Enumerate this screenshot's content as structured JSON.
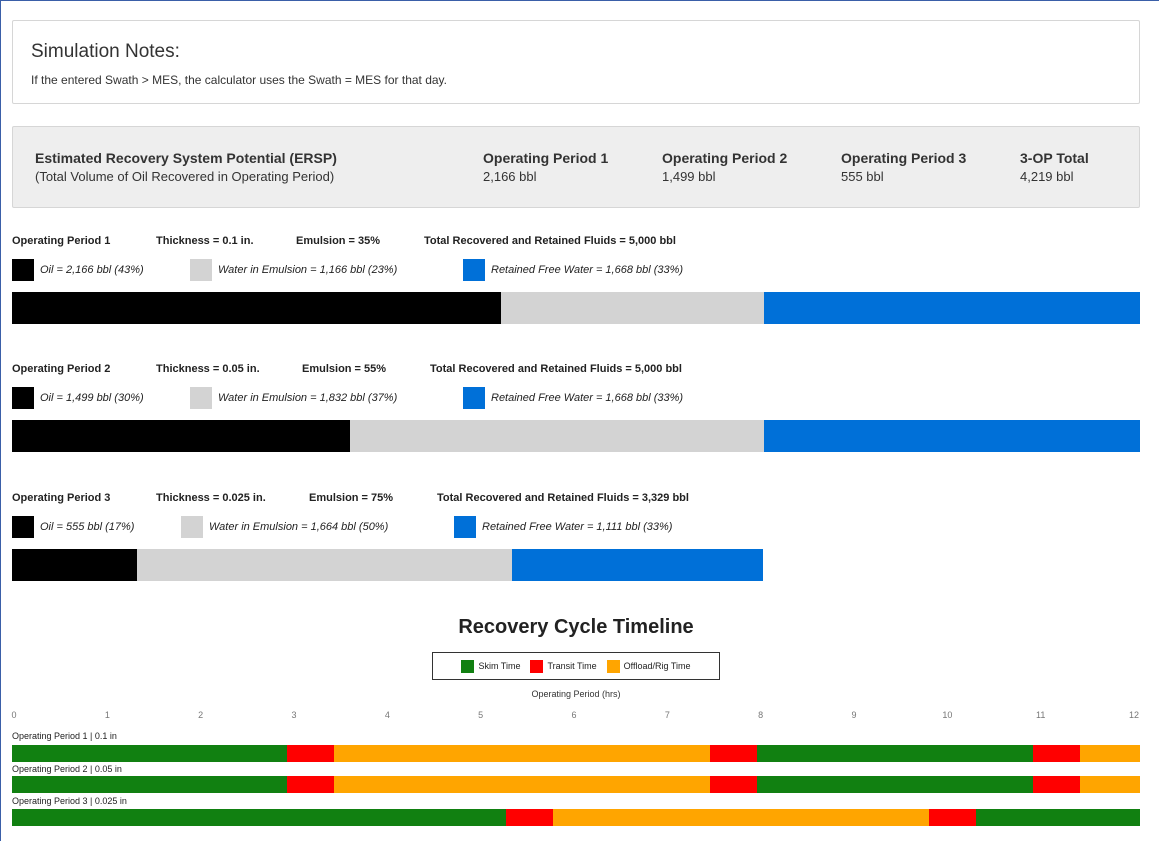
{
  "notes": {
    "title": "Simulation Notes:",
    "text": "If the entered Swath > MES, the calculator uses the Swath = MES for that day."
  },
  "ersp": {
    "label_main": "Estimated Recovery System Potential (ERSP)",
    "label_sub": "(Total Volume of Oil Recovered in Operating Period)",
    "columns": [
      {
        "header": "Operating Period 1",
        "value": "2,166 bbl"
      },
      {
        "header": "Operating Period 2",
        "value": "1,499 bbl"
      },
      {
        "header": "Operating Period 3",
        "value": "555 bbl"
      },
      {
        "header": "3-OP Total",
        "value": "4,219 bbl"
      }
    ]
  },
  "colors": {
    "oil": "#000000",
    "emulsion": "#d3d3d3",
    "free_water": "#0070d8",
    "skim": "#118011",
    "transit": "#ff0000",
    "offload": "#ffa500"
  },
  "periods": [
    {
      "name": "Operating Period 1",
      "thickness": "Thickness = 0.1 in.",
      "emulsion": "Emulsion = 35%",
      "total": "Total Recovered and Retained Fluids = 5,000 bbl",
      "legend": {
        "oil": "Oil = 2,166 bbl (43%)",
        "emulsion": "Water in Emulsion = 1,166 bbl (23%)",
        "free_water": "Retained Free Water = 1,668 bbl (33%)"
      },
      "bar": {
        "total_fraction": 1.0,
        "oil": 2166,
        "emulsion": 1166,
        "free_water": 1668
      }
    },
    {
      "name": "Operating Period 2",
      "thickness": "Thickness = 0.05 in.",
      "emulsion": "Emulsion = 55%",
      "total": "Total Recovered and Retained Fluids = 5,000 bbl",
      "legend": {
        "oil": "Oil = 1,499 bbl (30%)",
        "emulsion": "Water in Emulsion = 1,832 bbl (37%)",
        "free_water": "Retained Free Water = 1,668 bbl (33%)"
      },
      "bar": {
        "total_fraction": 1.0,
        "oil": 1499,
        "emulsion": 1832,
        "free_water": 1668
      }
    },
    {
      "name": "Operating Period 3",
      "thickness": "Thickness = 0.025 in.",
      "emulsion": "Emulsion = 75%",
      "total": "Total Recovered and Retained Fluids = 3,329 bbl",
      "legend": {
        "oil": "Oil = 555 bbl (17%)",
        "emulsion": "Water in Emulsion = 1,664 bbl (50%)",
        "free_water": "Retained Free Water = 1,111 bbl (33%)"
      },
      "bar": {
        "total_fraction": 0.666,
        "oil": 555,
        "emulsion": 1664,
        "free_water": 1111
      }
    }
  ],
  "timeline": {
    "title": "Recovery Cycle Timeline",
    "legend": [
      "Skim Time",
      "Transit Time",
      "Offload/Rig Time"
    ],
    "axis_label": "Operating Period (hrs)",
    "ticks": [
      "0",
      "1",
      "2",
      "3",
      "4",
      "5",
      "6",
      "7",
      "8",
      "9",
      "10",
      "11",
      "12"
    ],
    "rows": [
      {
        "label": "Operating Period 1 | 0.1 in",
        "segments": [
          [
            "skim",
            2.93
          ],
          [
            "transit",
            0.5
          ],
          [
            "offload",
            4.0
          ],
          [
            "transit",
            0.5
          ],
          [
            "skim",
            2.93
          ],
          [
            "transit",
            0.5
          ],
          [
            "offload",
            0.64
          ]
        ]
      },
      {
        "label": "Operating Period 2 | 0.05 in",
        "segments": [
          [
            "skim",
            2.93
          ],
          [
            "transit",
            0.5
          ],
          [
            "offload",
            4.0
          ],
          [
            "transit",
            0.5
          ],
          [
            "skim",
            2.93
          ],
          [
            "transit",
            0.5
          ],
          [
            "offload",
            0.64
          ]
        ]
      },
      {
        "label": "Operating Period 3 | 0.025 in",
        "segments": [
          [
            "skim",
            5.26
          ],
          [
            "transit",
            0.5
          ],
          [
            "offload",
            4.0
          ],
          [
            "transit",
            0.5
          ],
          [
            "skim",
            1.74
          ]
        ]
      }
    ]
  }
}
